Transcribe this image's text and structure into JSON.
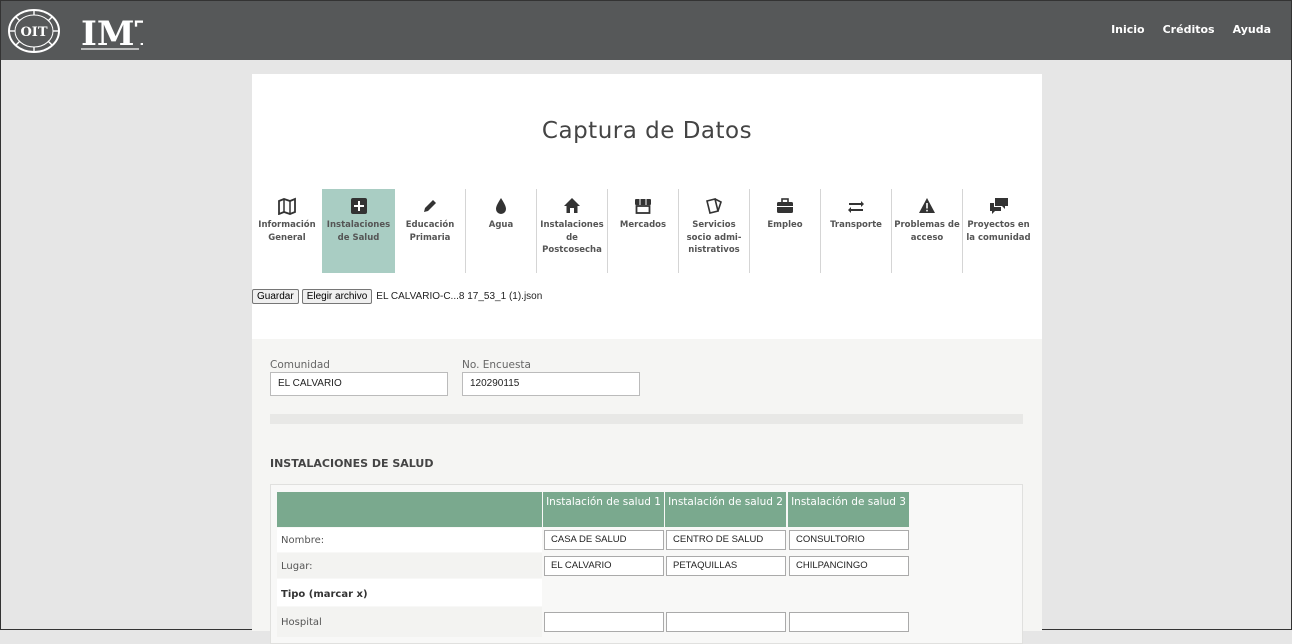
{
  "header": {
    "logo_left_text": "OIT",
    "logo_right_text": "IMT",
    "nav": [
      {
        "label": "Inicio"
      },
      {
        "label": "Créditos"
      },
      {
        "label": "Ayuda"
      }
    ]
  },
  "page": {
    "title": "Captura de Datos"
  },
  "tabs": [
    {
      "label": "Información General",
      "icon": "map-icon",
      "active": false
    },
    {
      "label": "Instalaciones de Salud",
      "icon": "plus-square-icon",
      "active": true
    },
    {
      "label": "Educación Primaria",
      "icon": "pencil-icon",
      "active": false
    },
    {
      "label": "Agua",
      "icon": "drop-icon",
      "active": false
    },
    {
      "label": "Instalaciones de Postcosecha",
      "icon": "home-icon",
      "active": false
    },
    {
      "label": "Mercados",
      "icon": "store-icon",
      "active": false
    },
    {
      "label": "Servicios socio admi- nistrativos",
      "icon": "documents-icon",
      "active": false
    },
    {
      "label": "Empleo",
      "icon": "briefcase-icon",
      "active": false
    },
    {
      "label": "Transporte",
      "icon": "exchange-icon",
      "active": false
    },
    {
      "label": "Problemas de acceso",
      "icon": "warning-icon",
      "active": false
    },
    {
      "label": "Proyectos en la comunidad",
      "icon": "comments-icon",
      "active": false
    }
  ],
  "filebar": {
    "save_label": "Guardar",
    "choose_label": "Elegir archivo",
    "filename": "EL CALVARIO-C...8 17_53_1 (1).json"
  },
  "form": {
    "comunidad_label": "Comunidad",
    "comunidad_value": "EL CALVARIO",
    "encuesta_label": "No. Encuesta",
    "encuesta_value": "120290115"
  },
  "section": {
    "title": "INSTALACIONES DE SALUD",
    "columns": [
      "Instalación de salud 1",
      "Instalación de salud 2",
      "Instalación de salud 3"
    ],
    "rows": [
      {
        "label": "Nombre:",
        "values": [
          "CASA DE SALUD",
          "CENTRO DE SALUD",
          "CONSULTORIO"
        ]
      },
      {
        "label": "Lugar:",
        "values": [
          "EL CALVARIO",
          "PETAQUILLAS",
          "CHILPANCINGO"
        ]
      }
    ],
    "tipo_label": "Tipo (marcar x)",
    "hospital_label": "Hospital",
    "hospital_values": [
      "",
      "",
      ""
    ]
  },
  "colors": {
    "topbar": "#565859",
    "active_tab": "#a9cdc3",
    "table_header": "#7aa98e"
  }
}
